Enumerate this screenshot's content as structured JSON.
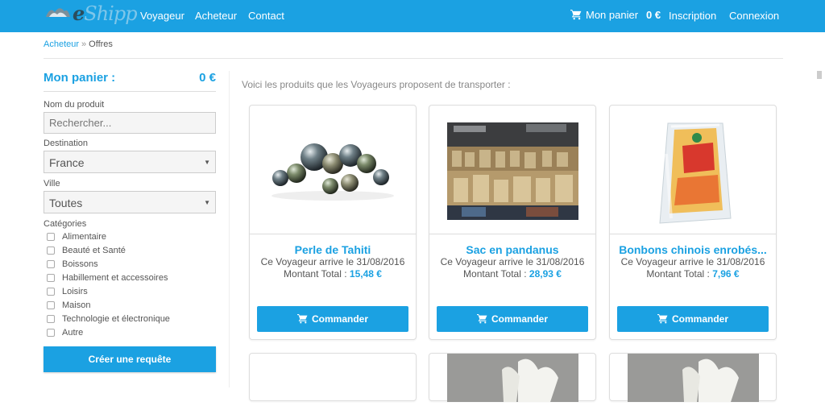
{
  "brand": {
    "name": "eShipp"
  },
  "nav": {
    "items": [
      "Voyageur",
      "Acheteur",
      "Contact"
    ]
  },
  "topcart": {
    "label": "Mon panier",
    "amount": "0 €"
  },
  "auth": {
    "signup": "Inscription",
    "login": "Connexion"
  },
  "breadcrumb": {
    "parent": "Acheteur",
    "separator": "»",
    "current": "Offres"
  },
  "sidebar": {
    "cart_title": "Mon panier :",
    "cart_amount": "0 €",
    "product_label": "Nom du produit",
    "search_placeholder": "Rechercher...",
    "destination_label": "Destination",
    "destination_value": "France",
    "city_label": "Ville",
    "city_value": "Toutes",
    "categories_label": "Catégories",
    "categories": [
      "Alimentaire",
      "Beauté et Santé",
      "Boissons",
      "Habillement et accessoires",
      "Loisirs",
      "Maison",
      "Technologie et électronique",
      "Autre"
    ],
    "request_button": "Créer une requête"
  },
  "main": {
    "intro": "Voici les produits que les Voyageurs proposent de transporter :",
    "button_label": "Commander",
    "total_label": "Montant Total :",
    "products": [
      {
        "title": "Perle de Tahiti",
        "arrival": "Ce Voyageur arrive le 31/08/2016",
        "price": "15,48 €"
      },
      {
        "title": "Sac en pandanus",
        "arrival": "Ce Voyageur arrive le 31/08/2016",
        "price": "28,93 €"
      },
      {
        "title": "Bonbons chinois enrobés...",
        "arrival": "Ce Voyageur arrive le 31/08/2016",
        "price": "7,96 €"
      }
    ]
  },
  "colors": {
    "accent": "#1ba1e2",
    "text": "#555555"
  },
  "icons": [
    "cart-icon",
    "checkbox-icon",
    "caret-down-icon"
  ]
}
